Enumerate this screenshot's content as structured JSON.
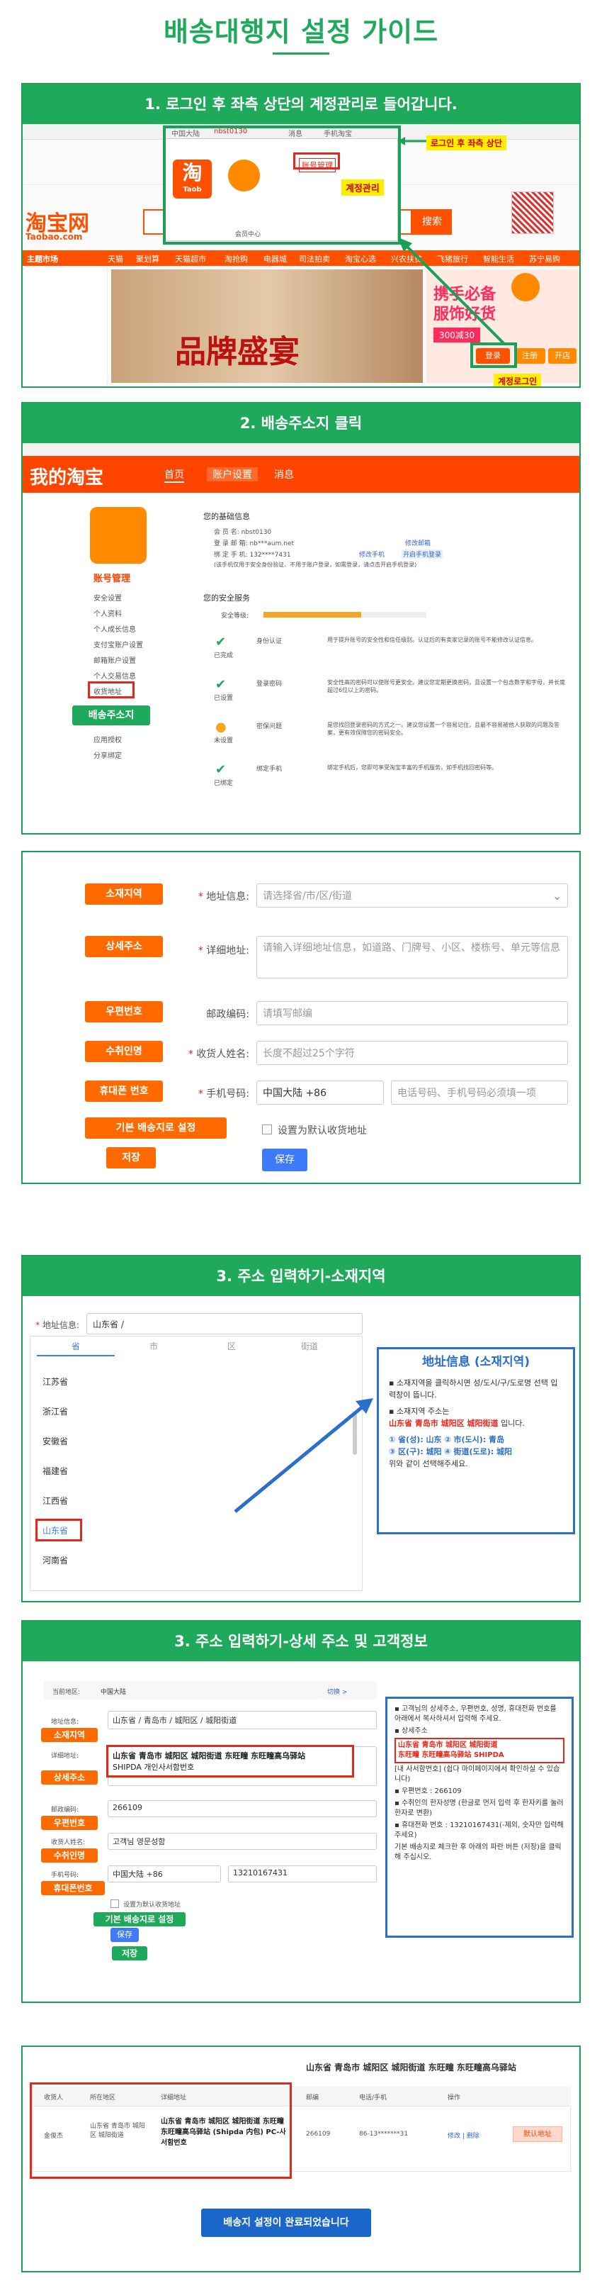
{
  "page": {
    "title": "배송대행지 설정 가이드"
  },
  "step1": {
    "heading": "1. 로그인 후 좌측 상단의 계정관리로 들어갑니다.",
    "tag_account": "로그인 후 좌측 상단",
    "tag_manage": "계정관리",
    "tag_login": "계정로그인",
    "site_name": "淘宝网",
    "site_url": "Taobao.com",
    "taobao_logo": "淘",
    "taobao_sub": "Taob",
    "topbar_items": [
      "中国大陆",
      "nbst0130",
      "消息",
      "手机淘宝"
    ],
    "search_btn": "搜索",
    "nav_items": [
      "主题市场",
      "天猫",
      "聚划算",
      "天猫超市",
      "淘抢购",
      "电器城",
      "司法拍卖",
      "淘宝心选",
      "兴农扶贫",
      "飞猪旅行",
      "智能生活",
      "苏宁易购"
    ],
    "banner_text": "品牌盛宴",
    "promo_text1": "携手必备",
    "promo_text2": "服饰好货",
    "promo_amount": "300减30",
    "btn_login": "登录",
    "btn_register": "注册",
    "btn_shop": "开店",
    "account_menu": "账号管理",
    "account_row": "会员中心"
  },
  "step2": {
    "heading": "2. 배송주소지 클릭",
    "my_taobao": "我的淘宝",
    "tabs": [
      "首页",
      "账户设置",
      "消息"
    ],
    "profile_title": "账号管理",
    "side_items": [
      "安全设置",
      "个人资料",
      "个人成长信息",
      "支付宝账户设置",
      "邮箱账户设置",
      "个人交易信息",
      "收货地址",
      "应用授权",
      "分享绑定"
    ],
    "addr_item": "收货地址",
    "addr_tag": "배송주소지",
    "basic_info_title": "您的基础信息",
    "basic_rows": [
      "会 员 名:   nbst0130",
      "登 录 邮 箱:   nb***aum.net",
      "绑 定 手 机:   132****7431",
      "(该手机仅用于安全身份验证、不用于账户登录，如需登录，请点击开启手机登录)"
    ],
    "basic_links": [
      "修改邮箱",
      "修改手机",
      "开启手机登录"
    ],
    "security_title": "您的安全服务",
    "security_level": "安全等级:",
    "security_rows": [
      {
        "status": "已完成",
        "name": "身份认证",
        "desc": "用于提升账号的安全性和信任级别。认证后的有卖家记录的账号不能修改认证信息。"
      },
      {
        "status": "已设置",
        "name": "登录密码",
        "desc": "安全性高的密码可以使账号更安全。建议您定期更换密码，且设置一个包含数字和字母，并长度超过6位以上的密码。"
      },
      {
        "status": "未设置",
        "name": "密保问题",
        "desc": "是您找回登录密码的方式之一。建议您设置一个容易记住，且最不容易被他人获取的问题及答案，更有效保障您的密码安全。"
      },
      {
        "status": "已绑定",
        "name": "绑定手机",
        "desc": "绑定手机后，您即可享受淘宝丰富的手机服务，如手机找回密码等。"
      }
    ]
  },
  "step3form": {
    "labels": {
      "region": "소재지역",
      "detail": "상세주소",
      "postcode": "우편번호",
      "recipient": "수취인명",
      "phone": "휴대폰 번호",
      "default": "기본 배송지로 설정",
      "save": "저장"
    },
    "fields": {
      "region_label": "地址信息:",
      "region_ph": "请选择省/市/区/街道",
      "detail_label": "详细地址:",
      "detail_ph": "请输入详细地址信息，如道路、门牌号、小区、楼栋号、单元等信息",
      "post_label": "邮政编码:",
      "post_ph": "请填写邮编",
      "name_label": "收货人姓名:",
      "name_ph": "长度不超过25个字符",
      "phone_label": "手机号码:",
      "phone_country": "中国大陆 +86",
      "phone_ph": "电话号码、手机号码必须填一项",
      "default_label": "设置为默认收货地址",
      "save_btn": "保存"
    }
  },
  "step3a": {
    "heading": "3. 주소 입력하기-소재지역",
    "addr_label": "地址信息:",
    "addr_value": "山东省 /",
    "tabs": [
      "省",
      "市",
      "区",
      "街道"
    ],
    "provinces": [
      "江苏省",
      "浙江省",
      "安徽省",
      "福建省",
      "江西省",
      "山东省",
      "河南省"
    ],
    "selected": "山东省",
    "info_title": "地址信息 (소재지역)",
    "info_l1": "소재지역을 클릭하시면 성/도시/구/도로명 선택 입력창이 뜹니다.",
    "info_l2": "소재지역 주소는",
    "info_addr": "山东省 青岛市 城阳区 城阳街道",
    "info_l2b": "입니다.",
    "info_l3": "① 省(성): 山东  ② 市(도시): 青岛",
    "info_l4": "③ 区(구): 城阳  ④ 街道(도로): 城阳",
    "info_l5": "위와 같이 선택해주세요."
  },
  "step3b": {
    "heading": "3. 주소 입력하기-상세 주소 및 고객정보",
    "country_label": "当前地区:",
    "country_value": "中国大陆",
    "switch": "切换 >",
    "region_label": "地址信息:",
    "region_value": "山东省 / 青岛市 / 城阳区 / 城阳街道",
    "detail_label": "详细地址:",
    "detail_value1": "山东省 青岛市 城阳区 城阳街道 东旺疃 东旺疃高乌驿站",
    "detail_value2": "SHIPDA 개인사서함번호",
    "post_label": "邮政编码:",
    "post_value": "266109",
    "name_label": "收货人姓名:",
    "name_value": "고객님 영문성함",
    "phone_label": "手机号码:",
    "phone_country": "中国大陆 +86",
    "phone_value": "13210167431",
    "default_label": "设置为默认收货地址",
    "save_btn": "保存",
    "tags": {
      "region": "소재지역",
      "detail": "상세주소",
      "postcode": "우편번호",
      "recipient": "수취인명",
      "phone": "휴대폰번호",
      "default": "기본 배송지로 설정",
      "save": "저장"
    },
    "info_p1": "고객님의 상세주소, 우편번호, 성명, 휴대전화 번호를 아래에서 복사하셔서 입력해 주세요.",
    "info_p2": "상세주소",
    "info_addr1": "山东省 青岛市 城阳区 城阳街道",
    "info_addr2": "东旺疃 东旺疃高乌驿站 SHIPDA",
    "info_p3": "[내 사서함번호] (쉽다 마이페이지에서 확인하실 수 있습니다)",
    "info_p4": "우편번호 : 266109",
    "info_p5": "수취인의 한자성명 (한글로 먼저 입력 후 한자키를 눌러 한자로 변환)",
    "info_p6": "휴대전화 번호 : 13210167431(-제외, 숫자만 입력해 주세요)",
    "info_p7": "기본 배송지로 체크한 후 아래의 파란 버튼 (저장)을 클릭해 주십시오."
  },
  "final": {
    "top_addr": "山东省 青岛市 城阳区 城阳街道 东旺疃 东旺疃高乌驿站",
    "headers": [
      "收货人",
      "所在地区",
      "详细地址",
      "邮编",
      "电话/手机",
      "操作"
    ],
    "row": {
      "name": "金俊杰",
      "region": "山东省 青岛市 城阳区 城阳街道",
      "detail": "山东省 青岛市 城阳区 城阳街道 东旺疃 东旺疃高乌驿站 (Shipda 内包) PC-사서함번호",
      "post": "266109",
      "phone": "86-13*******31",
      "ops": "修改 | 删除",
      "default_btn": "默认地址"
    },
    "done_btn": "배송지 설정이 완료되었습니다"
  },
  "colors": {
    "green": "#1eaa5a",
    "orange": "#ff6a00",
    "red": "#e8261a",
    "blue": "#3d7bfa"
  }
}
